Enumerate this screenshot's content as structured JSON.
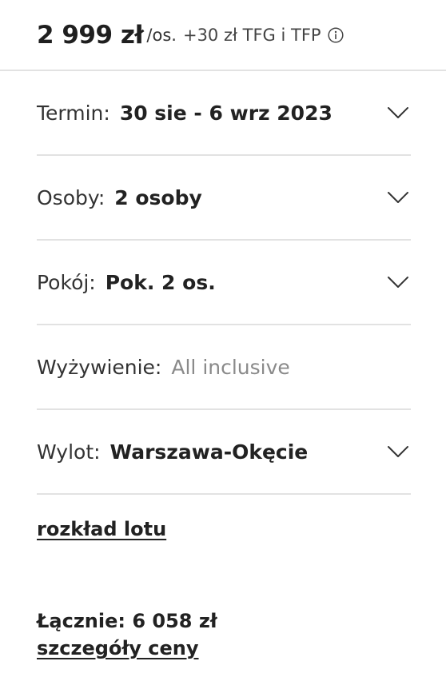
{
  "price": {
    "amount": "2 999 zł",
    "unit": "/os.",
    "extra": "+30 zł TFG i TFP",
    "info_icon": "info-circle-icon"
  },
  "options": [
    {
      "label": "Termin:",
      "value": "30 sie - 6 wrz 2023",
      "muted": false,
      "expandable": true
    },
    {
      "label": "Osoby:",
      "value": "2 osoby",
      "muted": false,
      "expandable": true
    },
    {
      "label": "Pokój:",
      "value": "Pok. 2 os.",
      "muted": false,
      "expandable": true
    },
    {
      "label": "Wyżywienie:",
      "value": "All inclusive",
      "muted": true,
      "expandable": false
    },
    {
      "label": "Wylot:",
      "value": "Warszawa-Okęcie",
      "muted": false,
      "expandable": true
    }
  ],
  "flight_schedule_link": "rozkład lotu",
  "total": "Łącznie: 6 058 zł",
  "price_details_link": "szczegóły ceny",
  "colors": {
    "text": "#222222",
    "muted": "#8a8a8a",
    "divider": "#e2e2e2"
  }
}
